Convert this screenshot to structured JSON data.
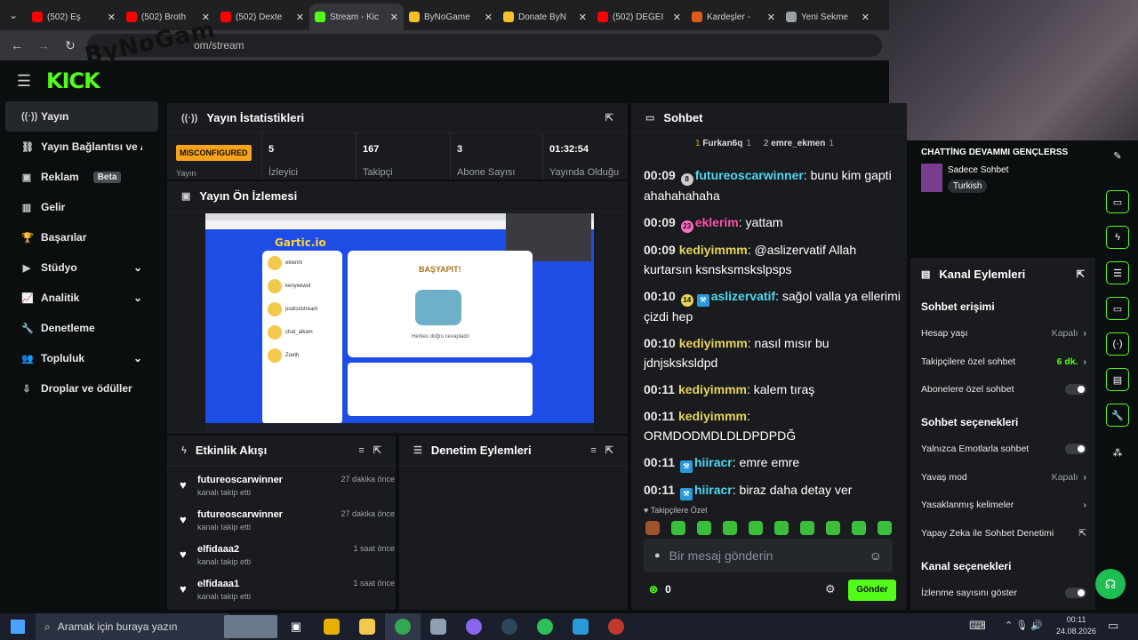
{
  "browser": {
    "tabs": [
      {
        "label": "(502) Eş",
        "color": "#ff0000"
      },
      {
        "label": "(502) Broth",
        "color": "#ff0000"
      },
      {
        "label": "(502) Dexte",
        "color": "#ff0000"
      },
      {
        "label": "Stream - Kic",
        "color": "#53fc18"
      },
      {
        "label": "ByNoGame",
        "color": "#f6c026"
      },
      {
        "label": "Donate ByN",
        "color": "#f6c026"
      },
      {
        "label": "(502) DEĞEI",
        "color": "#ff0000"
      },
      {
        "label": "Kardeşler -",
        "color": "#e05a1a"
      },
      {
        "label": "Yeni Sekme",
        "color": "#9aa0a6"
      }
    ],
    "url": "om/stream"
  },
  "overlay_logo": "ByNoGam",
  "brand": {
    "logo": "KICK",
    "accent": "#53fc18"
  },
  "sidebar": {
    "items": [
      {
        "icon": "broadcast-icon",
        "glyph": "((·))",
        "label": "Yayın"
      },
      {
        "icon": "link-icon",
        "glyph": "⛓",
        "label": "Yayın Bağlantısı ve Anahta"
      },
      {
        "icon": "ad-icon",
        "glyph": "▣",
        "label": "Reklam",
        "badge": "Beta"
      },
      {
        "icon": "revenue-icon",
        "glyph": "▥",
        "label": "Gelir"
      },
      {
        "icon": "trophy-icon",
        "glyph": "🏆",
        "label": "Başarılar"
      },
      {
        "icon": "studio-icon",
        "glyph": "▶",
        "label": "Stüdyo",
        "chev": "⌄"
      },
      {
        "icon": "analytics-icon",
        "glyph": "📈",
        "label": "Analitik",
        "chev": "⌄"
      },
      {
        "icon": "test-icon",
        "glyph": "🔧",
        "label": "Denetleme"
      },
      {
        "icon": "community-icon",
        "glyph": "👥",
        "label": "Topluluk",
        "chev": "⌄"
      },
      {
        "icon": "drops-icon",
        "glyph": "⇩",
        "label": "Droplar ve ödüller"
      }
    ]
  },
  "stats": {
    "title": "Yayın İstatistikleri",
    "status": "MISCONFIGURED",
    "status_sub": "Yayın",
    "items": [
      {
        "value": "5",
        "label": "İzleyici"
      },
      {
        "value": "167",
        "label": "Takipçi"
      },
      {
        "value": "3",
        "label": "Abone Sayısı"
      },
      {
        "value": "01:32:54",
        "label": "Yayında Olduğu"
      }
    ]
  },
  "preview": {
    "title": "Yayın Ön İzlemesi",
    "game_title": "Gartic.io",
    "word": "BAŞYAPIT!",
    "answer_hint": "Herkes doğru cevapladı!",
    "players": [
      "eklerim",
      "kenyeewol",
      "podcutstream",
      "chat_alkam",
      "Zoeth"
    ]
  },
  "activity": {
    "title": "Etkinlik Akışı",
    "events": [
      {
        "name": "futureoscarwinner",
        "sub": "kanalı takip etti",
        "time": "27 dakika önce"
      },
      {
        "name": "futureoscarwinner",
        "sub": "kanalı takip etti",
        "time": "27 dakika önce"
      },
      {
        "name": "elfidaaa2",
        "sub": "kanalı takip etti",
        "time": "1 saat önce"
      },
      {
        "name": "elfidaaa1",
        "sub": "kanalı takip etti",
        "time": "1 saat önce"
      }
    ]
  },
  "mod_actions": {
    "title": "Denetim Eylemleri"
  },
  "chat": {
    "title": "Sohbet",
    "top_users": [
      {
        "name": "Furkan6q",
        "count": "1"
      },
      {
        "name": "emre_ekmen",
        "count": "1"
      }
    ],
    "messages": [
      {
        "time": "00:09",
        "badge": "8",
        "badge_color": "#cccccc",
        "user": "futureoscarwinner",
        "color": "#4dd8f0",
        "text": "bunu kim gapti ahahahahaha"
      },
      {
        "time": "00:09",
        "badge": "23",
        "badge_color": "#ff6ec7",
        "user": "eklerim",
        "color": "#ff4fa8",
        "text": "yattam"
      },
      {
        "time": "00:09",
        "user": "kediyimmm",
        "color": "#e6d45a",
        "text": "@aslizervatif Allah kurtarsın ksnsksmskslpsps"
      },
      {
        "time": "00:10",
        "badge": "14",
        "badge_color": "#e6d45a",
        "badge2": "⚒",
        "user": "aslizervatif",
        "color": "#4dd8f0",
        "text": "sağol valla ya ellerimi çizdi hep"
      },
      {
        "time": "00:10",
        "user": "kediyimmm",
        "color": "#e6d45a",
        "text": "nasıl mısır bu jdnjsksksldpd"
      },
      {
        "time": "00:11",
        "user": "kediyimmm",
        "color": "#e6d45a",
        "text": "kalem tıraş"
      },
      {
        "time": "00:11",
        "user": "kediyimmm",
        "color": "#e6d45a",
        "text": "ORMDODMDLDLDPDPDĞ"
      },
      {
        "time": "00:11",
        "badge2": "⚒",
        "user": "hiiracr",
        "color": "#4dd8f0",
        "text": "emre emre"
      },
      {
        "time": "00:11",
        "badge2": "⚒",
        "user": "hiiracr",
        "color": "#4dd8f0",
        "text": "biraz daha detay ver"
      }
    ],
    "follower_label": "Takipçilere Özel",
    "input_placeholder": "Bir mesaj gönderin",
    "points": "0",
    "send_label": "Gönder"
  },
  "channel": {
    "stream_title": "CHATTİNG DEVAMMI GENÇLERSS",
    "category": "Sadece Sohbet",
    "tag": "Turkish",
    "actions_title": "Kanal Eylemleri",
    "chat_access_title": "Sohbet erişimi",
    "account_age": "Hesap yaşı",
    "account_age_val": "Kapalı",
    "followers_only": "Takipçilere özel sohbet",
    "followers_only_val": "6 dk.",
    "subs_only": "Abonelere özel sohbet",
    "chat_options_title": "Sohbet seçenekleri",
    "emotes_only": "Yalnızca Emotlarla sohbet",
    "slow_mode": "Yavaş mod",
    "slow_mode_val": "Kapalı",
    "banned_words": "Yasaklanmış kelimeler",
    "ai_mod": "Yapay Zeka ile Sohbet Denetimi",
    "channel_options_title": "Kanal seçenekleri",
    "show_viewers": "İzlenme sayısını göster"
  },
  "taskbar": {
    "search_placeholder": "Aramak için buraya yazın",
    "time": "00:11",
    "date": "24.08.2026"
  }
}
